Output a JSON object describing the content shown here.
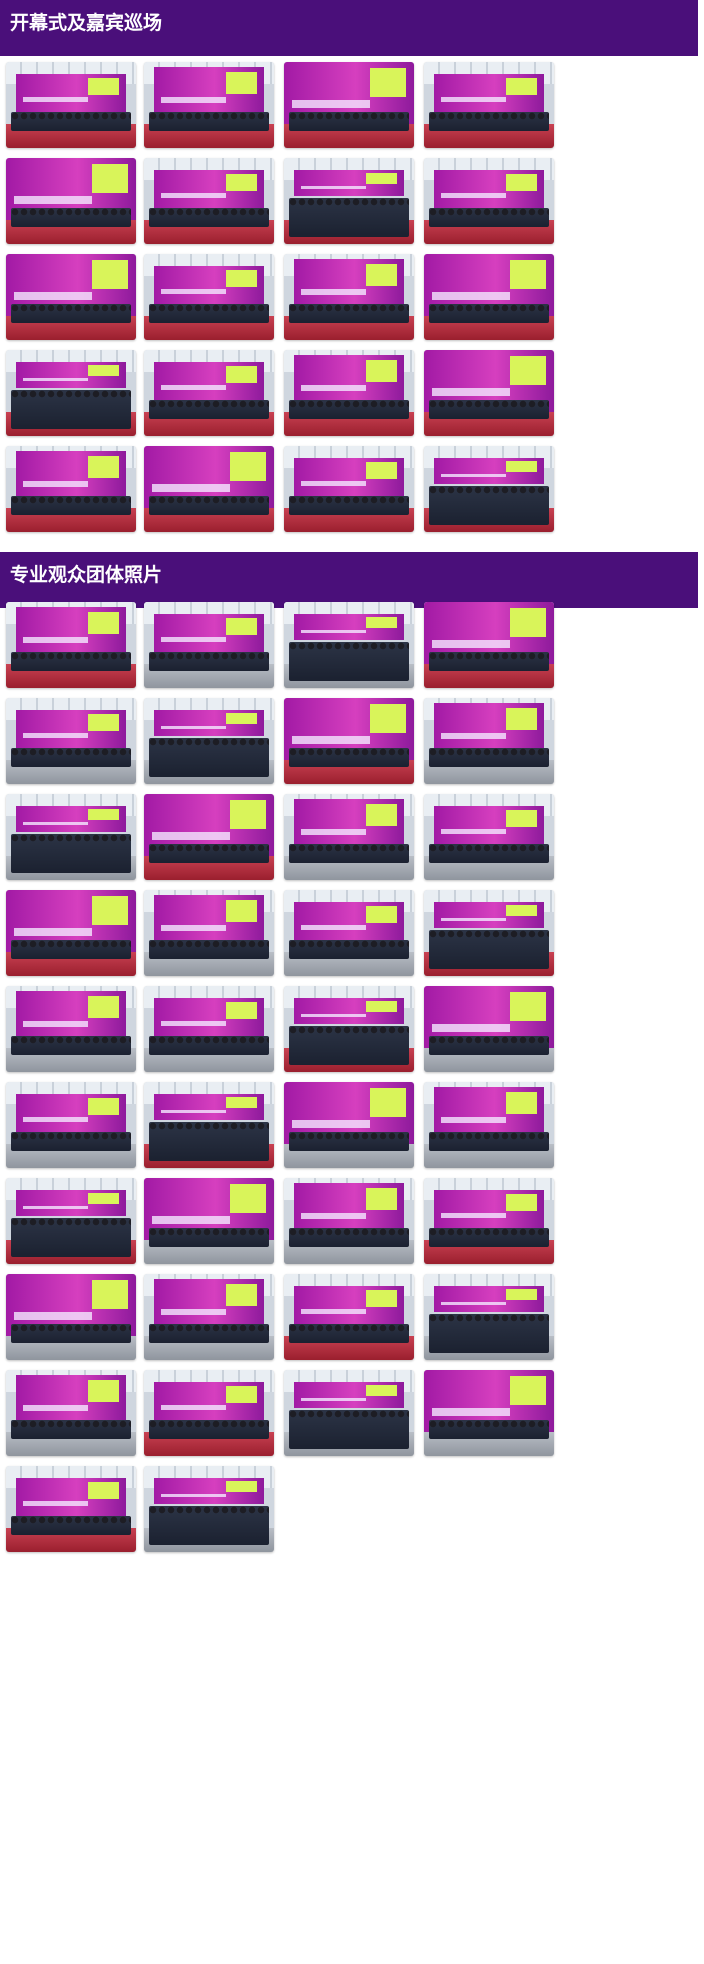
{
  "sections": [
    {
      "title": "开幕式及嘉宾巡场",
      "photos": [
        "opening-ribbon-1",
        "opening-guests-1",
        "opening-guests-2",
        "opening-guests-3",
        "opening-stage-1",
        "opening-speech",
        "opening-stage-2",
        "opening-stage-3",
        "hall-tour-1",
        "hall-tour-2",
        "hall-tour-3",
        "hall-tour-4",
        "hall-tour-5",
        "hall-tour-6",
        "hall-tour-7",
        "hall-tour-8",
        "booth-visit-1",
        "booth-visit-2",
        "booth-visit-3",
        "booth-visit-4"
      ]
    },
    {
      "title": "专业观众团体照片",
      "photos": [
        "group-1",
        "group-2",
        "group-3",
        "group-4",
        "group-5",
        "group-6",
        "group-7",
        "group-8",
        "group-9",
        "group-10",
        "group-11",
        "group-12",
        "group-13",
        "group-14",
        "group-15",
        "group-16",
        "group-17",
        "group-18",
        "group-19",
        "group-20",
        "group-21",
        "group-22",
        "group-23",
        "group-24",
        "group-25",
        "group-26",
        "group-27",
        "group-28",
        "group-29",
        "group-30",
        "group-31",
        "group-32",
        "group-33",
        "group-34",
        "group-35",
        "group-36",
        "group-37",
        "group-38"
      ]
    }
  ],
  "colors": {
    "header_bar": "#4a0f7a",
    "banner_magenta": "#c52fb5",
    "banner_lime": "#d9f45a",
    "carpet_red": "#b8303f"
  }
}
